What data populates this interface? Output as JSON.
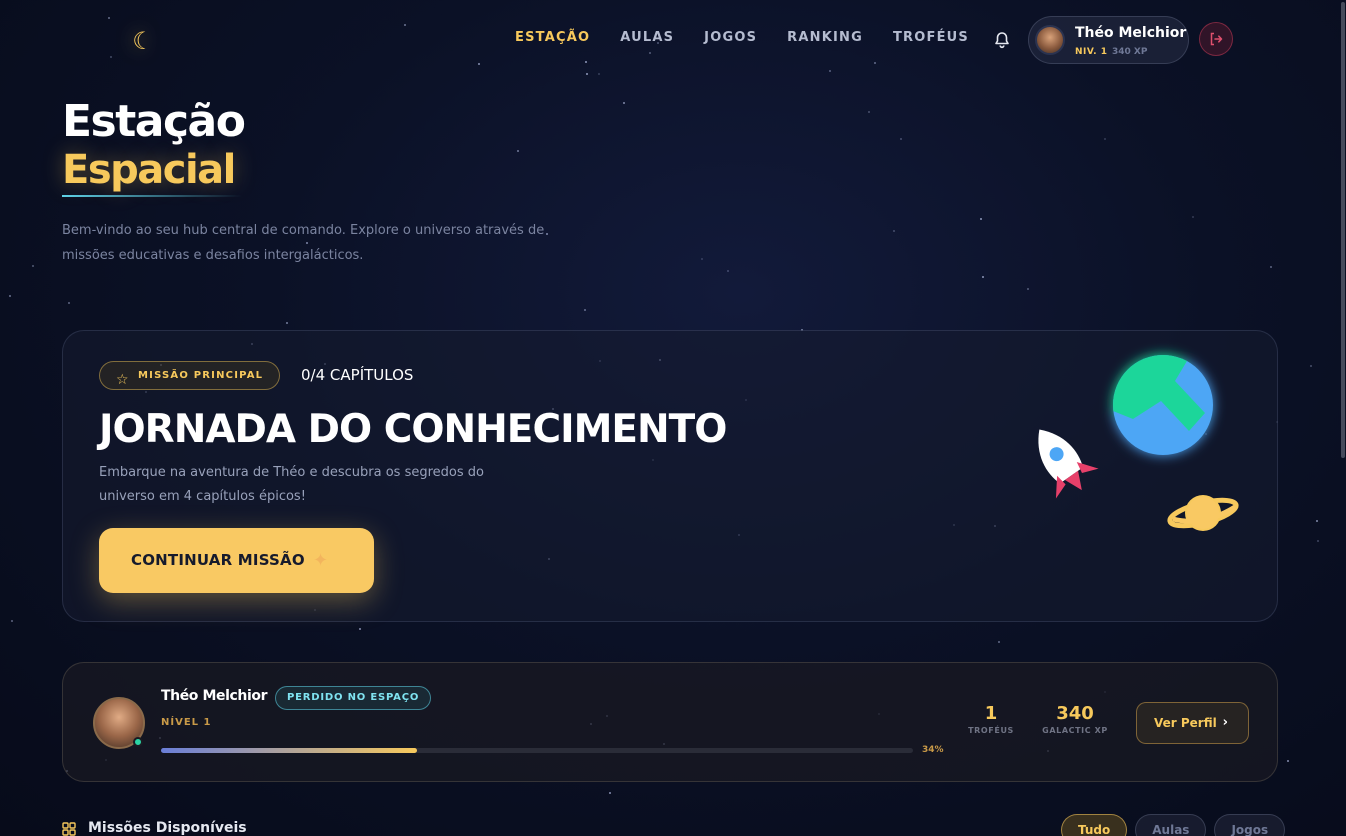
{
  "nav": {
    "links": [
      "ESTAÇÃO",
      "AULAS",
      "JOGOS",
      "RANKING",
      "TROFÉUS"
    ],
    "active_index": 0
  },
  "user_chip": {
    "name": "Théo Melchior",
    "level": "NIV. 1",
    "xp": "340 XP"
  },
  "hero": {
    "title_line1": "Estação",
    "title_line2": "Espacial",
    "description": "Bem-vindo ao seu hub central de comando. Explore o universo através de missões educativas e desafios intergalácticos."
  },
  "mission": {
    "badge": "MISSÃO PRINCIPAL",
    "chapters": "0/4 CAPÍTULOS",
    "title": "JORNADA DO CONHECIMENTO",
    "description": "Embarque na aventura de Théo e descubra os segredos do universo em 4 capítulos épicos!",
    "button": "CONTINUAR MISSÃO"
  },
  "profile": {
    "name": "Théo Melchior",
    "tag": "PERDIDO NO ESPAÇO",
    "level": "NÍVEL 1",
    "progress_percent": 34,
    "progress_label": "34%",
    "stats": [
      {
        "value": "1",
        "label": "TROFÉUS"
      },
      {
        "value": "340",
        "label": "GALACTIC XP"
      }
    ],
    "button": "Ver Perfil"
  },
  "missions_section": {
    "heading": "Missões Disponíveis",
    "filters": [
      "Tudo",
      "Aulas",
      "Jogos"
    ],
    "active_filter": 0
  },
  "colors": {
    "accent": "#f7c95c",
    "cyan": "#5fd3e8",
    "background": "#0b1126"
  },
  "icons": [
    "moon-icon",
    "bell-icon",
    "logout-icon",
    "star-icon",
    "sparkle-icon",
    "chevron-right-icon",
    "grid-icon",
    "rocket-icon",
    "planet-icon",
    "saturn-icon"
  ]
}
